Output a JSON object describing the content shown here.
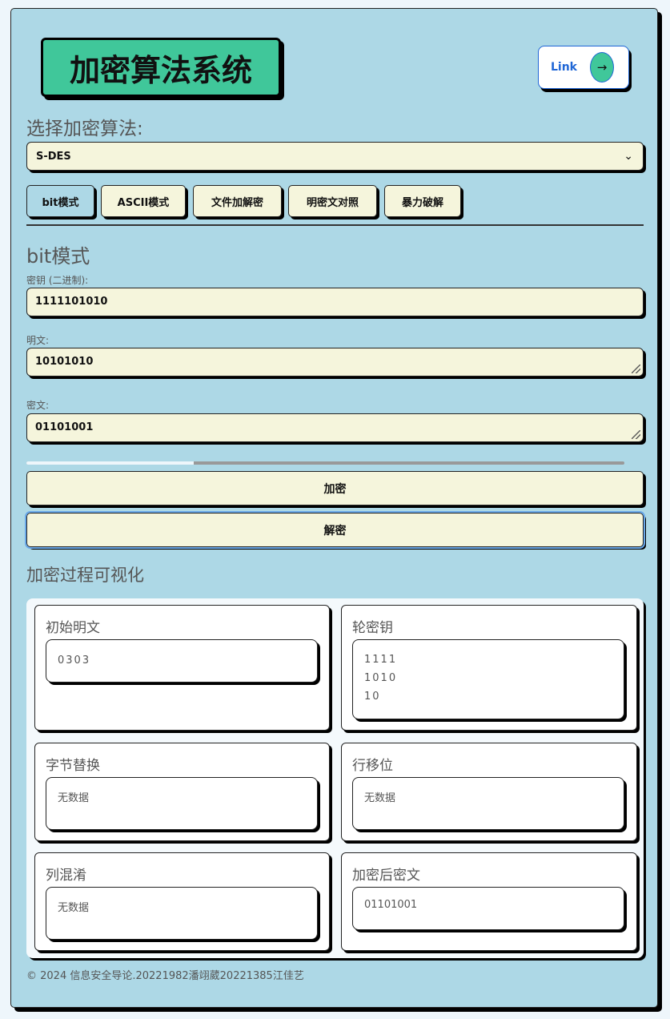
{
  "header": {
    "title": "加密算法系统",
    "link_label": "Link",
    "link_icon": "arrow-right-icon"
  },
  "algorithm": {
    "label": "选择加密算法:",
    "selected": "S-DES",
    "chevron": "⌄"
  },
  "tabs": [
    {
      "label": "bit模式",
      "active": true
    },
    {
      "label": "ASCII模式",
      "active": false
    },
    {
      "label": "文件加解密",
      "active": false
    },
    {
      "label": "明密文对照",
      "active": false
    },
    {
      "label": "暴力破解",
      "active": false
    }
  ],
  "form": {
    "section_title": "bit模式",
    "key_label": "密钥 (二进制):",
    "key_value": "1111101010",
    "plaintext_label": "明文:",
    "plaintext_value": "10101010",
    "ciphertext_label": "密文:",
    "ciphertext_value": "01101001",
    "progress_fraction": 0.28,
    "encrypt_label": "加密",
    "decrypt_label": "解密"
  },
  "visualization": {
    "title": "加密过程可视化",
    "cards": {
      "initial_plaintext": {
        "label": "初始明文",
        "value": "0303"
      },
      "round_key": {
        "label": "轮密钥",
        "value": "1111\n1010\n10"
      },
      "sub_bytes": {
        "label": "字节替换",
        "value": "无数据"
      },
      "shift_rows": {
        "label": "行移位",
        "value": "无数据"
      },
      "mix_columns": {
        "label": "列混淆",
        "value": "无数据"
      },
      "final_ciphertext": {
        "label": "加密后密文",
        "value": "01101001"
      }
    }
  },
  "footer": {
    "text": "© 2024 信息安全导论.20221982潘翊葳20221385江佳艺"
  }
}
